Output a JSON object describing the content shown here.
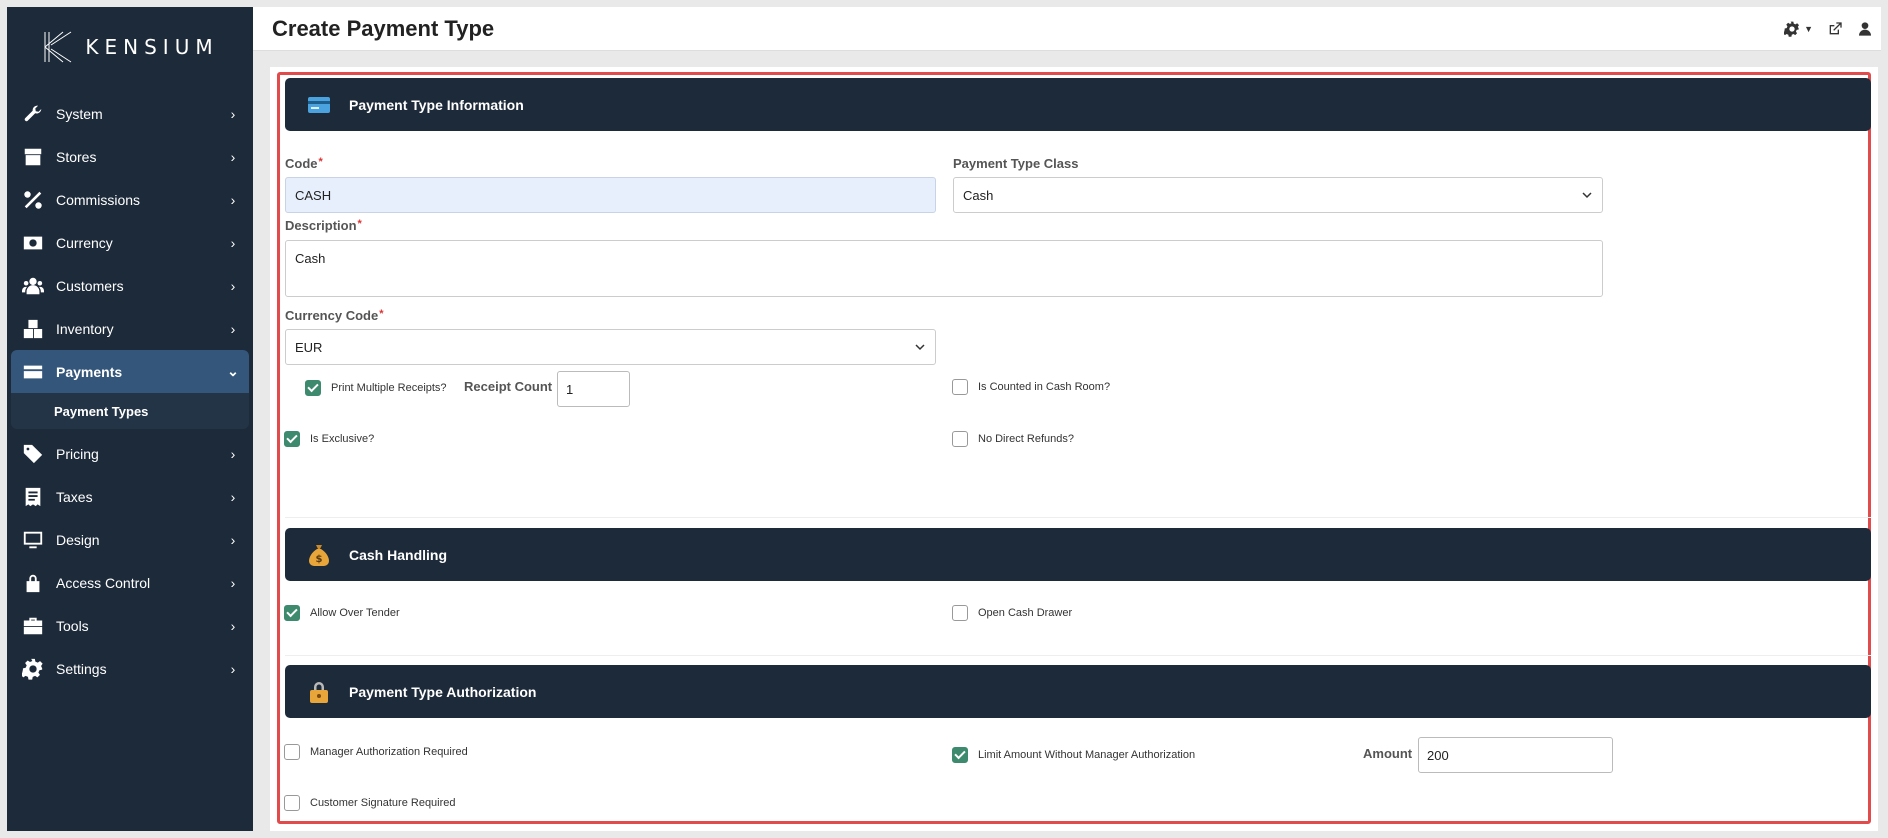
{
  "brand": {
    "name": "KENSIUM"
  },
  "page": {
    "title": "Create Payment Type"
  },
  "sidebar": {
    "items": [
      {
        "label": "System",
        "icon": "wrench-icon"
      },
      {
        "label": "Stores",
        "icon": "store-icon"
      },
      {
        "label": "Commissions",
        "icon": "percent-icon"
      },
      {
        "label": "Currency",
        "icon": "money-icon"
      },
      {
        "label": "Customers",
        "icon": "users-icon"
      },
      {
        "label": "Inventory",
        "icon": "boxes-icon"
      },
      {
        "label": "Payments",
        "icon": "credit-card-icon",
        "expanded": true
      },
      {
        "label": "Pricing",
        "icon": "tags-icon"
      },
      {
        "label": "Taxes",
        "icon": "receipt-icon"
      },
      {
        "label": "Design",
        "icon": "monitor-icon"
      },
      {
        "label": "Access Control",
        "icon": "lock-icon"
      },
      {
        "label": "Tools",
        "icon": "toolbox-icon"
      },
      {
        "label": "Settings",
        "icon": "gear-icon"
      }
    ],
    "payments_sub": {
      "label": "Payment Types"
    }
  },
  "sections": {
    "info": {
      "title": "Payment Type Information"
    },
    "cash": {
      "title": "Cash Handling"
    },
    "auth": {
      "title": "Payment Type Authorization"
    }
  },
  "form": {
    "code": {
      "label": "Code",
      "value": "CASH",
      "required": "*"
    },
    "class": {
      "label": "Payment Type Class",
      "value": "Cash"
    },
    "description": {
      "label": "Description",
      "value": "Cash",
      "required": "*"
    },
    "currency": {
      "label": "Currency Code",
      "value": "EUR",
      "required": "*"
    },
    "print_multiple": {
      "label": "Print Multiple Receipts?",
      "checked": true
    },
    "receipt_count": {
      "label": "Receipt Count",
      "value": "1"
    },
    "counted_cash_room": {
      "label": "Is Counted in Cash Room?",
      "checked": false
    },
    "exclusive": {
      "label": "Is Exclusive?",
      "checked": true
    },
    "no_direct_refunds": {
      "label": "No Direct Refunds?",
      "checked": false
    },
    "allow_over_tender": {
      "label": "Allow Over Tender",
      "checked": true
    },
    "open_cash_drawer": {
      "label": "Open Cash Drawer",
      "checked": false
    },
    "manager_auth": {
      "label": "Manager Authorization Required",
      "checked": false
    },
    "limit_amount": {
      "label": "Limit Amount Without Manager Authorization",
      "checked": true
    },
    "amount": {
      "label": "Amount",
      "value": "200"
    },
    "customer_signature": {
      "label": "Customer Signature Required",
      "checked": false
    }
  },
  "colors": {
    "sidebar": "#1d2a3a",
    "active": "#34567a",
    "check": "#3d8a6e",
    "highlight_frame": "#e24b4b"
  }
}
